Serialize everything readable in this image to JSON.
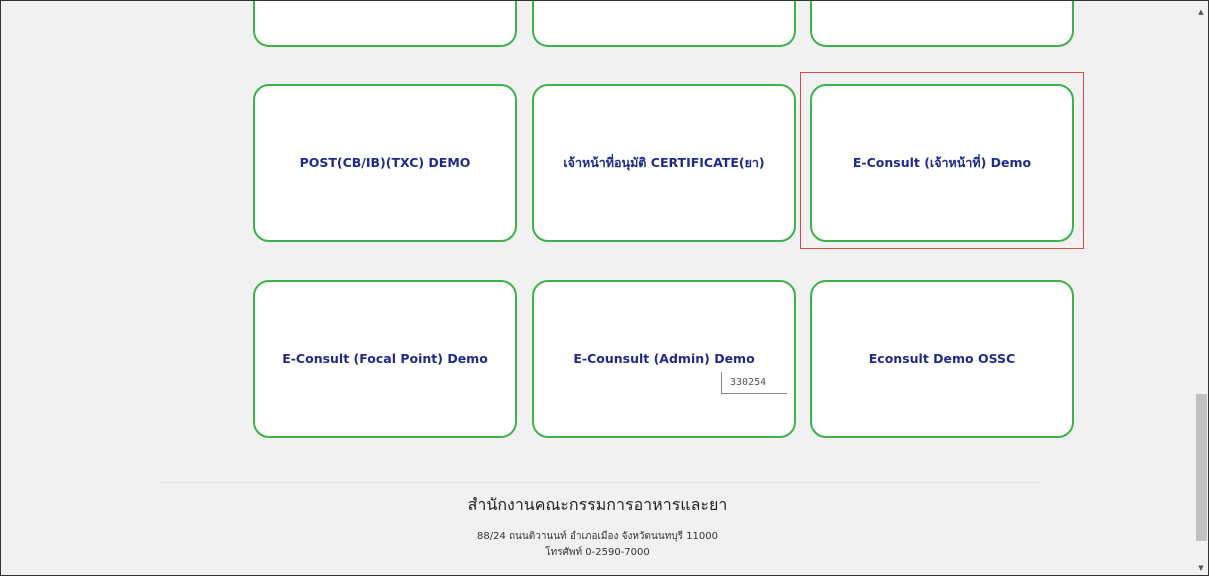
{
  "cards": {
    "top_row": [
      "",
      "",
      ""
    ],
    "row1": [
      "POST(CB/IB)(TXC) DEMO",
      "เจ้าหน้าที่อนุมัติ CERTIFICATE(ยา)",
      "E-Consult (เจ้าหน้าที่) Demo"
    ],
    "row2": [
      "E-Consult (Focal Point) Demo",
      "E-Counsult (Admin) Demo",
      "Econsult Demo OSSC"
    ]
  },
  "stepper_value": "330254",
  "footer": {
    "title": "สำนักงานคณะกรรมการอาหารและยา",
    "address": "88/24 ถนนติวานนท์ อำเภอเมือง จังหวัดนนทบุรี 11000",
    "phone": "โทรศัพท์ 0-2590-7000"
  },
  "scrollbar": {
    "up_glyph": "▲",
    "down_glyph": "▼"
  },
  "colors": {
    "card_border": "#3bb34a",
    "card_text": "#1f2a8c",
    "highlight": "#e54848"
  }
}
